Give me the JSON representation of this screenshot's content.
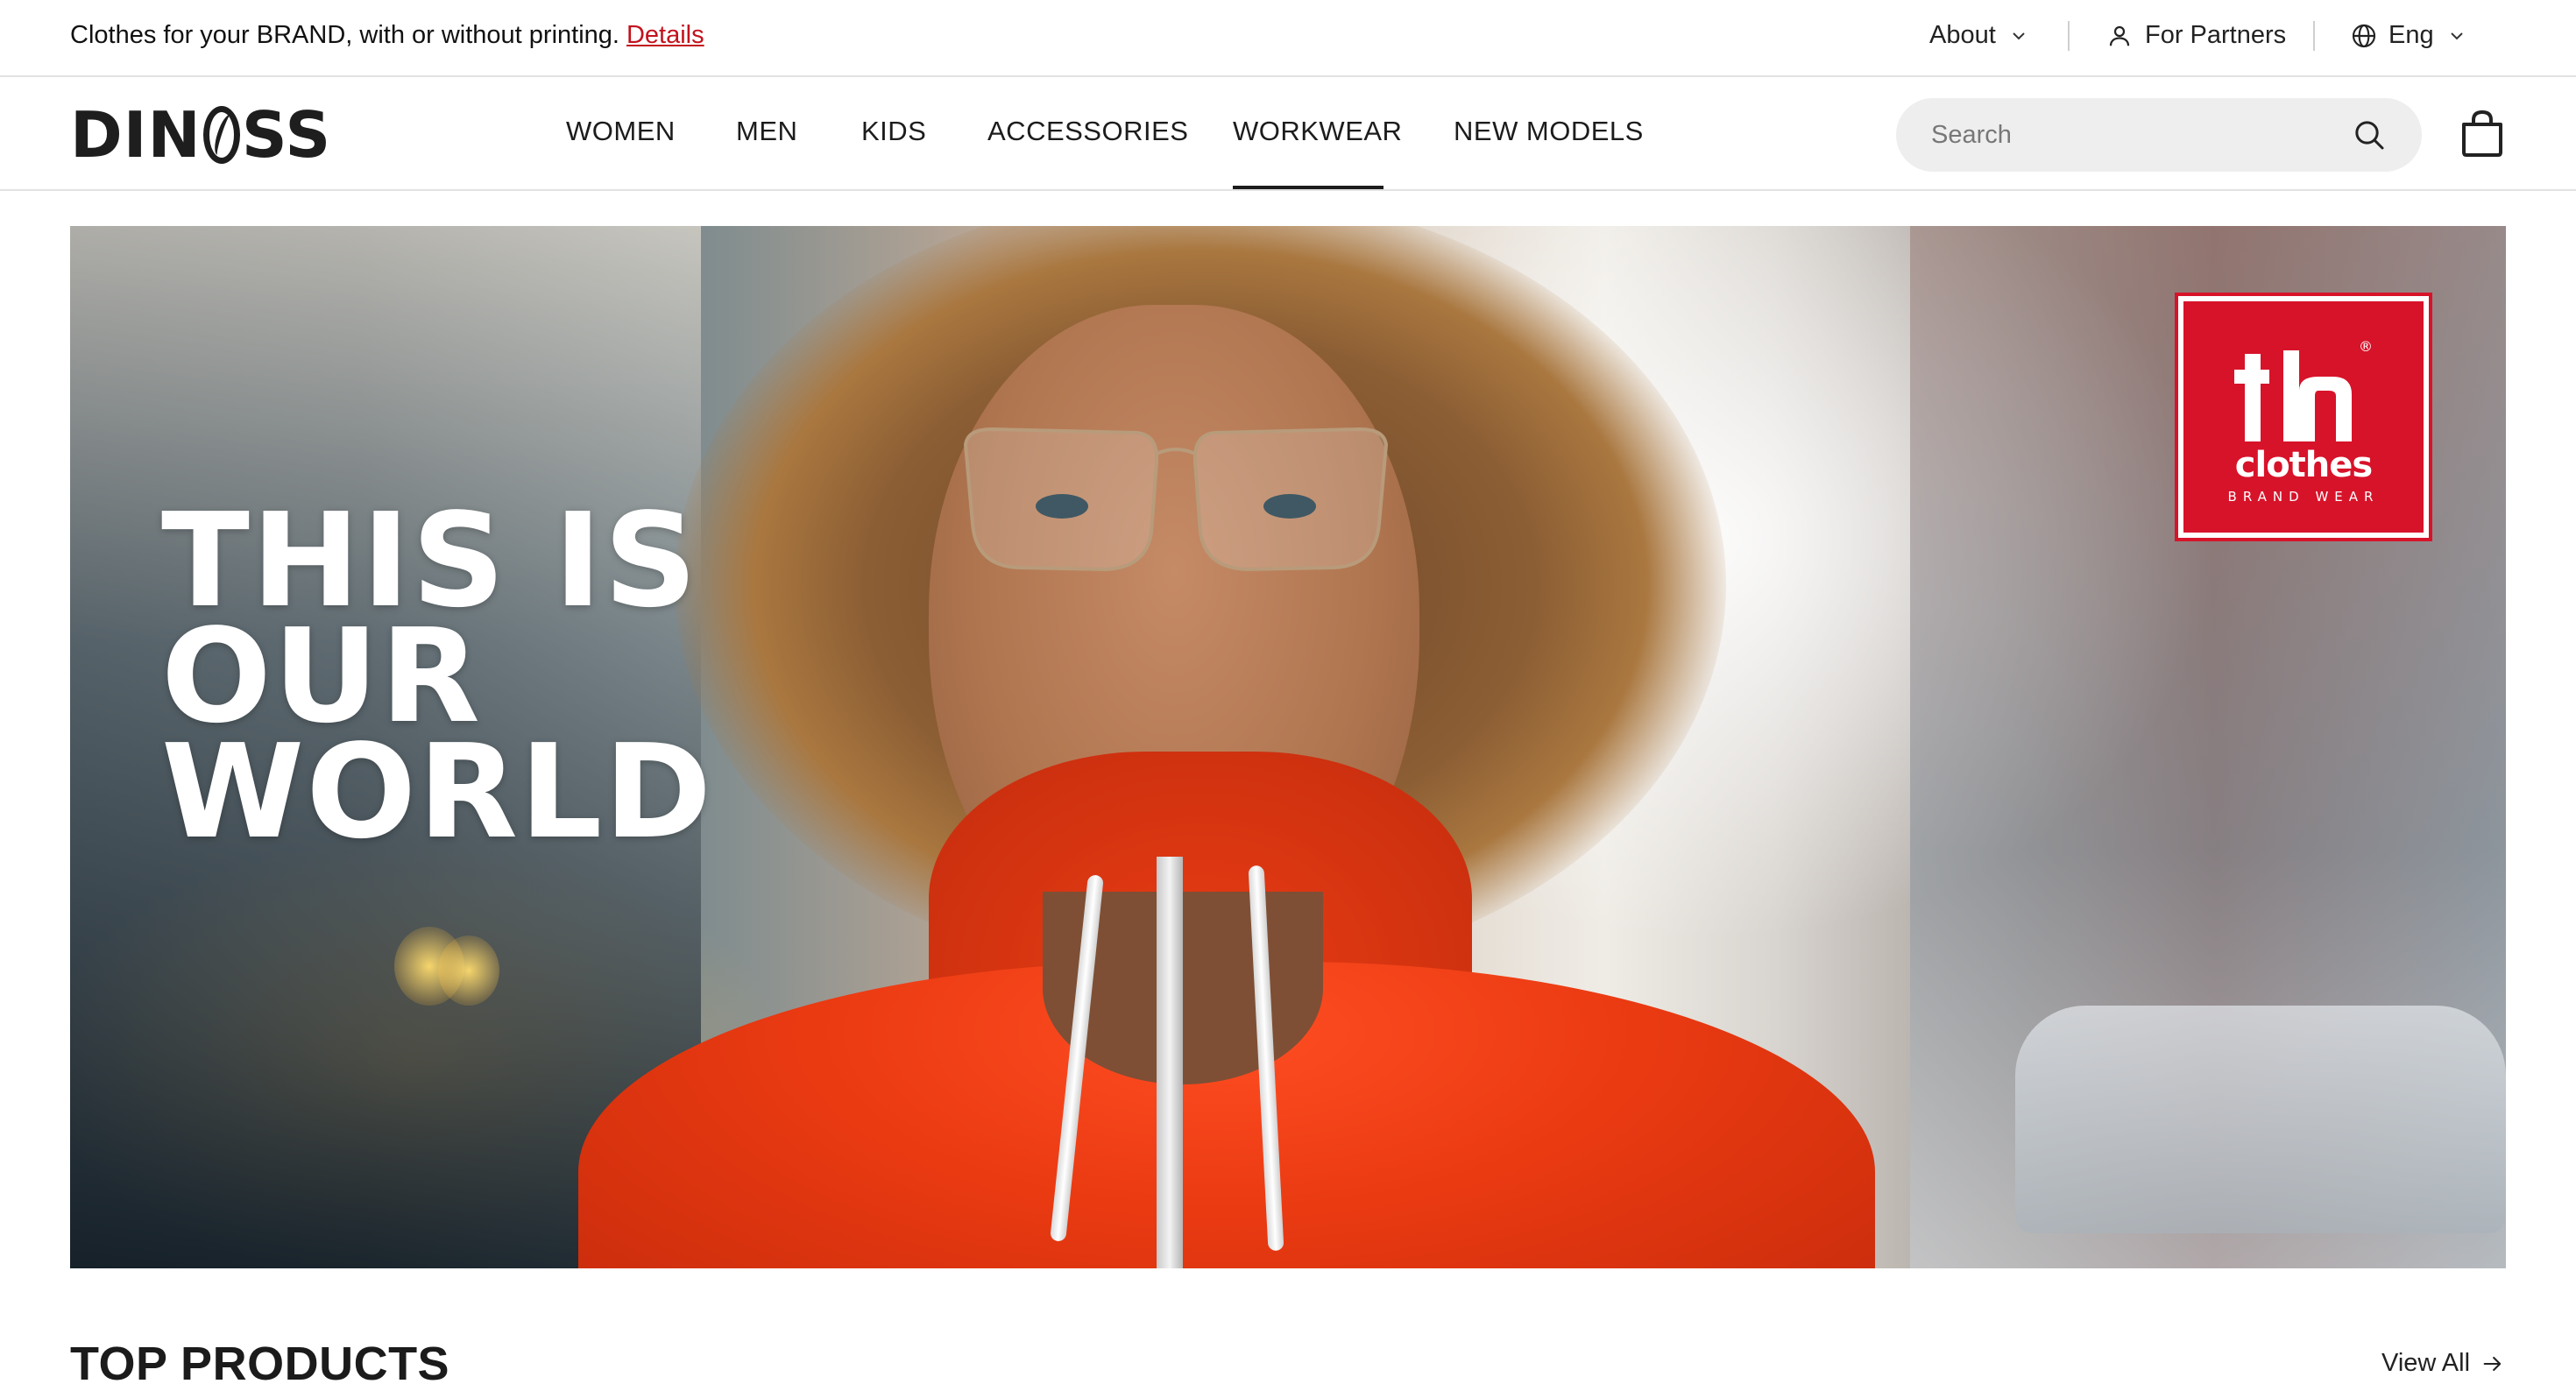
{
  "announcement": {
    "text": "Clothes for your BRAND, with or without printing.",
    "link_label": "Details",
    "link_color": "#c2121d"
  },
  "utility_nav": {
    "about_label": "About",
    "partners_label": "For Partners",
    "language_label": "Eng",
    "icons": [
      "chevron-down-icon",
      "user-icon",
      "globe-icon"
    ]
  },
  "brand": {
    "logo_text_left": "DIN",
    "logo_text_right": "SS"
  },
  "main_nav": {
    "items": [
      {
        "label": "WOMEN"
      },
      {
        "label": "MEN"
      },
      {
        "label": "KIDS"
      },
      {
        "label": "ACCESSORIES"
      },
      {
        "label": "WORKWEAR",
        "active": true
      },
      {
        "label": "NEW MODELS"
      }
    ]
  },
  "search": {
    "placeholder": "Search",
    "value": "",
    "icon": "search-icon"
  },
  "cart": {
    "icon": "shopping-bag-icon"
  },
  "hero": {
    "headline_lines": [
      "THIS IS",
      "OUR",
      "WORLD"
    ],
    "badge": {
      "mark_text": "th",
      "name": "clothes",
      "sub": "BRAND WEAR",
      "color": "#d7132a"
    }
  },
  "top_products": {
    "title": "TOP PRODUCTS",
    "view_all_label": "View All",
    "view_all_icon": "arrow-right-icon"
  }
}
